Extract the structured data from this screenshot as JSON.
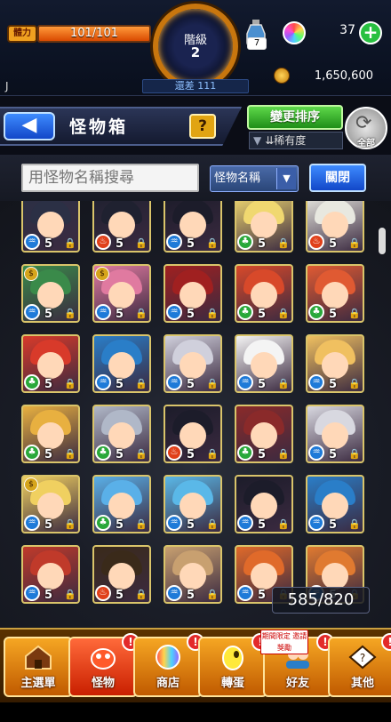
{
  "status": {
    "stamina_label": "體力",
    "stamina_value": "101/101",
    "stamina_fill": 1.0,
    "rank_label": "階級",
    "rank_value": "2",
    "potion_count": "7",
    "orb_count": "37",
    "player_name": "J",
    "gap_label": "還差 111",
    "gold": "1,650,600"
  },
  "header": {
    "back_icon": "back-arrow-icon",
    "title": "怪物箱",
    "help_label": "?",
    "sort_label": "變更排序",
    "sort_filter": "稀有度",
    "sort_all_label": "全部"
  },
  "search": {
    "placeholder": "用怪物名稱搜尋",
    "field_label": "怪物名稱",
    "close_label": "關閉"
  },
  "grid": {
    "capacity": "585/820",
    "monsters": [
      {
        "hair": "#2b3045",
        "elem": "water",
        "lvl": "5",
        "badge": ""
      },
      {
        "hair": "#1f2130",
        "elem": "fire",
        "lvl": "5",
        "badge": ""
      },
      {
        "hair": "#1c1c2a",
        "elem": "water",
        "lvl": "5",
        "badge": ""
      },
      {
        "hair": "#f0d870",
        "elem": "wood",
        "lvl": "5",
        "badge": ""
      },
      {
        "hair": "#e8e8e0",
        "elem": "fire",
        "lvl": "5",
        "badge": ""
      },
      {
        "hair": "#3a8a4a",
        "elem": "water",
        "lvl": "5",
        "badge": "coin"
      },
      {
        "hair": "#e07aa0",
        "elem": "water",
        "lvl": "5",
        "badge": "coin"
      },
      {
        "hair": "#a02020",
        "elem": "water",
        "lvl": "5",
        "badge": ""
      },
      {
        "hair": "#d8492a",
        "elem": "wood",
        "lvl": "5",
        "badge": ""
      },
      {
        "hair": "#e05a32",
        "elem": "wood",
        "lvl": "5",
        "badge": ""
      },
      {
        "hair": "#d83a2a",
        "elem": "wood",
        "lvl": "5",
        "badge": ""
      },
      {
        "hair": "#2a7ec8",
        "elem": "water",
        "lvl": "5",
        "badge": ""
      },
      {
        "hair": "#d0d0dc",
        "elem": "water",
        "lvl": "5",
        "badge": ""
      },
      {
        "hair": "#f4f4f4",
        "elem": "water",
        "lvl": "5",
        "badge": ""
      },
      {
        "hair": "#f0c060",
        "elem": "water",
        "lvl": "5",
        "badge": ""
      },
      {
        "hair": "#e8b040",
        "elem": "wood",
        "lvl": "5",
        "badge": ""
      },
      {
        "hair": "#b0b8c8",
        "elem": "wood",
        "lvl": "5",
        "badge": ""
      },
      {
        "hair": "#1c1c2a",
        "elem": "fire",
        "lvl": "5",
        "badge": ""
      },
      {
        "hair": "#8a2a2a",
        "elem": "wood",
        "lvl": "5",
        "badge": ""
      },
      {
        "hair": "#d8d8e0",
        "elem": "water",
        "lvl": "5",
        "badge": ""
      },
      {
        "hair": "#f0d060",
        "elem": "water",
        "lvl": "5",
        "badge": "coin"
      },
      {
        "hair": "#5ab0e8",
        "elem": "wood",
        "lvl": "5",
        "badge": ""
      },
      {
        "hair": "#5ab8e8",
        "elem": "water",
        "lvl": "5",
        "badge": ""
      },
      {
        "hair": "#1c1c2a",
        "elem": "water",
        "lvl": "5",
        "badge": ""
      },
      {
        "hair": "#2a7ec8",
        "elem": "water",
        "lvl": "5",
        "badge": ""
      },
      {
        "hair": "#c03a2a",
        "elem": "water",
        "lvl": "5",
        "badge": ""
      },
      {
        "hair": "#3a2a1a",
        "elem": "fire",
        "lvl": "5",
        "badge": ""
      },
      {
        "hair": "#c8a070",
        "elem": "water",
        "lvl": "5",
        "badge": ""
      },
      {
        "hair": "#e06a2a",
        "elem": "water",
        "lvl": "5",
        "badge": ""
      },
      {
        "hair": "#e07a30",
        "elem": "water",
        "lvl": "5",
        "badge": ""
      }
    ]
  },
  "nav": {
    "items": [
      {
        "label": "主選單",
        "icon": "house-icon",
        "alert": false,
        "active": false
      },
      {
        "label": "怪物",
        "icon": "monster-icon",
        "alert": true,
        "active": true
      },
      {
        "label": "商店",
        "icon": "orb-shop-icon",
        "alert": true,
        "active": false
      },
      {
        "label": "轉蛋",
        "icon": "gacha-egg-icon",
        "alert": true,
        "active": false
      },
      {
        "label": "好友",
        "icon": "friends-icon",
        "alert": true,
        "active": false
      },
      {
        "label": "其他",
        "icon": "misc-icon",
        "alert": true,
        "active": false
      }
    ],
    "limited_tag": "期間限定 邀請獎勵"
  },
  "colors": {
    "accent": "#f5a623",
    "fire": "#e0401a",
    "water": "#1e7ad8",
    "wood": "#2aa83a"
  }
}
